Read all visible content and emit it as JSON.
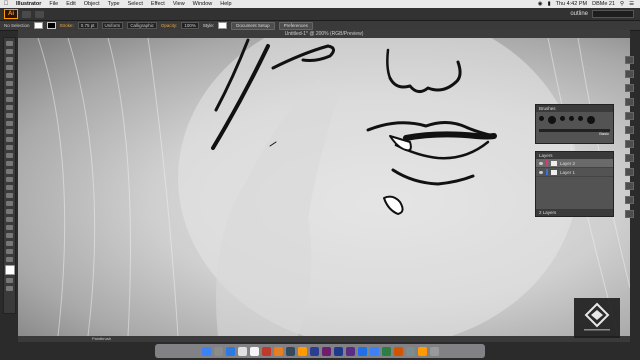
{
  "menubar": {
    "app_name": "Illustrator",
    "items": [
      "File",
      "Edit",
      "Object",
      "Type",
      "Select",
      "Effect",
      "View",
      "Window",
      "Help"
    ],
    "clock": "Thu 4:42 PM",
    "user": "DBMe 21"
  },
  "appbar": {
    "logo": "Ai",
    "workspace": "outline"
  },
  "controlbar": {
    "selection": "No Selection",
    "stroke_label": "Stroke:",
    "stroke_weight": "0.75 pt",
    "stroke_profile": "Uniform",
    "brush": "Calligraphic",
    "opacity_label": "Opacity:",
    "opacity": "100%",
    "style_label": "Style:",
    "document_setup": "Document Setup",
    "preferences": "Preferences"
  },
  "document": {
    "title": "Untitled-1* @ 200% (RGB/Preview)"
  },
  "brushes_panel": {
    "title": "Brushes",
    "basic": "Basic"
  },
  "layers_panel": {
    "title": "Layers",
    "layers": [
      {
        "name": "Layer 2",
        "color": "#e0357a",
        "selected": true
      },
      {
        "name": "Layer 1",
        "color": "#3b6fe0",
        "selected": false
      }
    ],
    "footer": "2 Layers"
  },
  "statusbar": {
    "tool": "Paintbrush"
  },
  "colors": {
    "ai_orange": "#ff9a00",
    "panel": "#535353",
    "chrome": "#323232"
  },
  "dock_apps": [
    "#3b82f6",
    "#8b8b8b",
    "#2a7ae2",
    "#e0e0e0",
    "#f5f5f5",
    "#c0392b",
    "#e67e22",
    "#34495e",
    "#ff9a00",
    "#2c3e8f",
    "#6d1e6e",
    "#1e3a8a",
    "#5a2d82",
    "#1f6feb",
    "#3b82f6",
    "#2d7d46",
    "#d35400",
    "#7f8c8d",
    "#ff9a00",
    "#999"
  ]
}
